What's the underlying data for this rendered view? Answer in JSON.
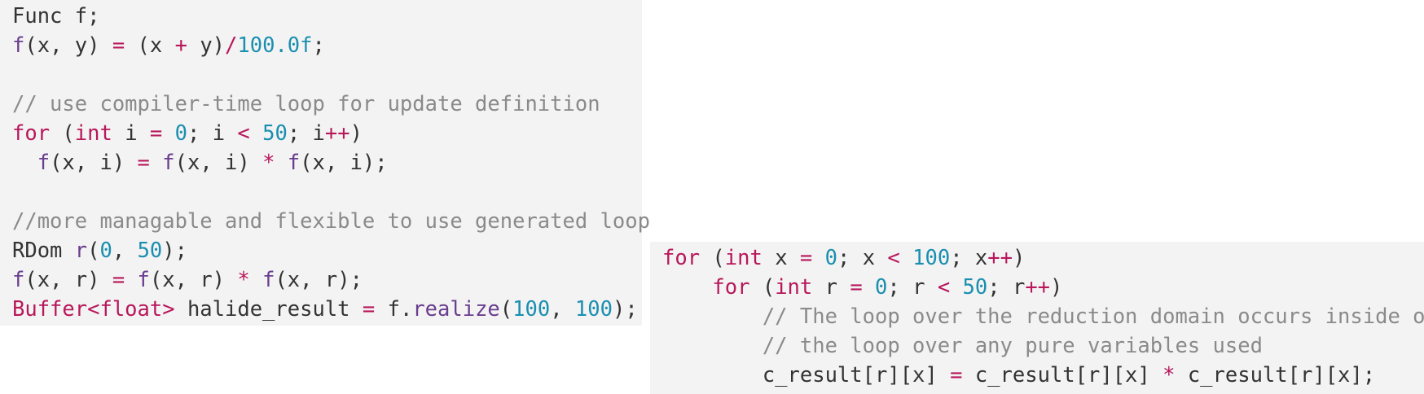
{
  "colors": {
    "background": "#f3f3f3",
    "plain": "#333333",
    "keyword": "#b8175b",
    "function": "#6a3d8f",
    "number": "#1a8fb0",
    "comment": "#8a8a8a"
  },
  "blocks": [
    {
      "lines": [
        [
          [
            "pl",
            "Func f;"
          ]
        ],
        [
          [
            "fn",
            "f"
          ],
          [
            "pl",
            "(x, y) "
          ],
          [
            "op",
            "="
          ],
          [
            "pl",
            " (x "
          ],
          [
            "op",
            "+"
          ],
          [
            "pl",
            " y)"
          ],
          [
            "op",
            "/"
          ],
          [
            "num",
            "100.0f"
          ],
          [
            "pl",
            ";"
          ]
        ],
        [],
        [
          [
            "cm",
            "// use compiler-time loop for update definition"
          ]
        ],
        [
          [
            "kw",
            "for"
          ],
          [
            "pl",
            " ("
          ],
          [
            "kw",
            "int"
          ],
          [
            "pl",
            " i "
          ],
          [
            "op",
            "="
          ],
          [
            "pl",
            " "
          ],
          [
            "num",
            "0"
          ],
          [
            "pl",
            "; i "
          ],
          [
            "op",
            "<"
          ],
          [
            "pl",
            " "
          ],
          [
            "num",
            "50"
          ],
          [
            "pl",
            "; i"
          ],
          [
            "op",
            "++"
          ],
          [
            "pl",
            ")"
          ]
        ],
        [
          [
            "pl",
            "  "
          ],
          [
            "fn",
            "f"
          ],
          [
            "pl",
            "(x, i) "
          ],
          [
            "op",
            "="
          ],
          [
            "pl",
            " "
          ],
          [
            "fn",
            "f"
          ],
          [
            "pl",
            "(x, i) "
          ],
          [
            "op",
            "*"
          ],
          [
            "pl",
            " "
          ],
          [
            "fn",
            "f"
          ],
          [
            "pl",
            "(x, i);"
          ]
        ],
        [],
        [
          [
            "cm",
            "//more managable and flexible to use generated loop"
          ]
        ],
        [
          [
            "pl",
            "RDom "
          ],
          [
            "fn",
            "r"
          ],
          [
            "pl",
            "("
          ],
          [
            "num",
            "0"
          ],
          [
            "pl",
            ", "
          ],
          [
            "num",
            "50"
          ],
          [
            "pl",
            ");"
          ]
        ],
        [
          [
            "fn",
            "f"
          ],
          [
            "pl",
            "(x, r) "
          ],
          [
            "op",
            "="
          ],
          [
            "pl",
            " "
          ],
          [
            "fn",
            "f"
          ],
          [
            "pl",
            "(x, r) "
          ],
          [
            "op",
            "*"
          ],
          [
            "pl",
            " "
          ],
          [
            "fn",
            "f"
          ],
          [
            "pl",
            "(x, r);"
          ]
        ],
        [
          [
            "kw",
            "Buffer<float>"
          ],
          [
            "pl",
            " halide_result "
          ],
          [
            "op",
            "="
          ],
          [
            "pl",
            " f."
          ],
          [
            "fn",
            "realize"
          ],
          [
            "pl",
            "("
          ],
          [
            "num",
            "100"
          ],
          [
            "pl",
            ", "
          ],
          [
            "num",
            "100"
          ],
          [
            "pl",
            ");"
          ]
        ]
      ]
    },
    {
      "lines": [
        [
          [
            "kw",
            "for"
          ],
          [
            "pl",
            " ("
          ],
          [
            "kw",
            "int"
          ],
          [
            "pl",
            " x "
          ],
          [
            "op",
            "="
          ],
          [
            "pl",
            " "
          ],
          [
            "num",
            "0"
          ],
          [
            "pl",
            "; x "
          ],
          [
            "op",
            "<"
          ],
          [
            "pl",
            " "
          ],
          [
            "num",
            "100"
          ],
          [
            "pl",
            "; x"
          ],
          [
            "op",
            "++"
          ],
          [
            "pl",
            ")"
          ]
        ],
        [
          [
            "pl",
            "    "
          ],
          [
            "kw",
            "for"
          ],
          [
            "pl",
            " ("
          ],
          [
            "kw",
            "int"
          ],
          [
            "pl",
            " r "
          ],
          [
            "op",
            "="
          ],
          [
            "pl",
            " "
          ],
          [
            "num",
            "0"
          ],
          [
            "pl",
            "; r "
          ],
          [
            "op",
            "<"
          ],
          [
            "pl",
            " "
          ],
          [
            "num",
            "50"
          ],
          [
            "pl",
            "; r"
          ],
          [
            "op",
            "++"
          ],
          [
            "pl",
            ")"
          ]
        ],
        [
          [
            "pl",
            "        "
          ],
          [
            "cm",
            "// The loop over the reduction domain occurs inside of"
          ]
        ],
        [
          [
            "pl",
            "        "
          ],
          [
            "cm",
            "// the loop over any pure variables used"
          ]
        ],
        [
          [
            "pl",
            "        c_result[r][x] "
          ],
          [
            "op",
            "="
          ],
          [
            "pl",
            " c_result[r][x] "
          ],
          [
            "op",
            "*"
          ],
          [
            "pl",
            " c_result[r][x];"
          ]
        ]
      ]
    }
  ]
}
